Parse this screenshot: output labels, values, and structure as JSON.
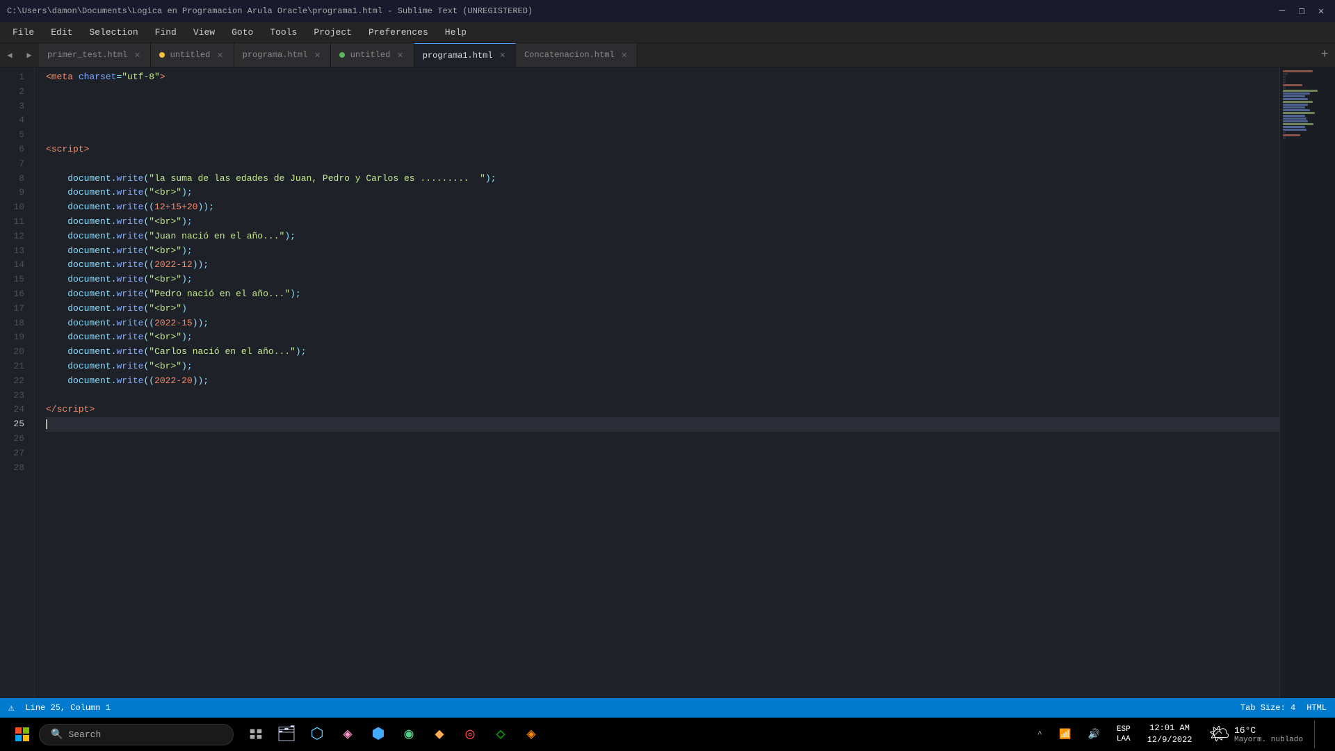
{
  "titlebar": {
    "text": "C:\\Users\\damon\\Documents\\Logica en Programacion Arula Oracle\\programa1.html - Sublime Text (UNREGISTERED)"
  },
  "menubar": {
    "items": [
      "File",
      "Edit",
      "Selection",
      "Find",
      "View",
      "Goto",
      "Tools",
      "Project",
      "Preferences",
      "Help"
    ]
  },
  "tabs": [
    {
      "label": "primer_test.html",
      "active": false,
      "dot": false,
      "dot_color": ""
    },
    {
      "label": "untitled",
      "active": false,
      "dot": true,
      "dot_color": "#f0c040"
    },
    {
      "label": "programa.html",
      "active": false,
      "dot": false,
      "dot_color": ""
    },
    {
      "label": "untitled",
      "active": false,
      "dot": true,
      "dot_color": "#5cb85c"
    },
    {
      "label": "programa1.html",
      "active": true,
      "dot": false,
      "dot_color": ""
    },
    {
      "label": "Concatenacion.html",
      "active": false,
      "dot": false,
      "dot_color": ""
    }
  ],
  "statusbar": {
    "left": "Line 25, Column 1",
    "tab_size": "Tab Size: 4",
    "language": "HTML"
  },
  "taskbar": {
    "search_label": "Search",
    "clock": "12:01 AM",
    "date": "12/9/2022",
    "weather_temp": "16°C",
    "weather_desc": "Mayorm. nublado",
    "language_code": "ESP\nLAA"
  }
}
